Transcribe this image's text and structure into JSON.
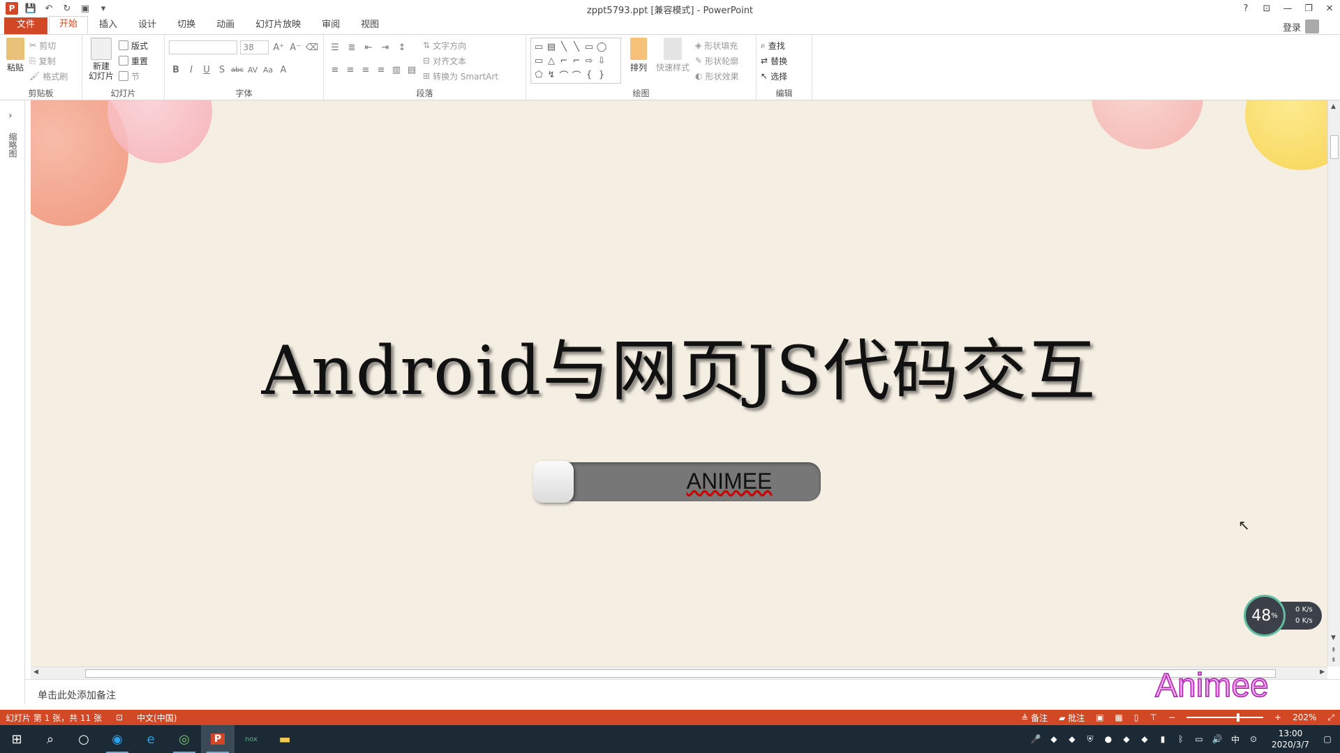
{
  "window": {
    "title": "zppt5793.ppt [兼容模式] - PowerPoint",
    "controls": [
      "?",
      "⊡",
      "—",
      "❐",
      "✕"
    ]
  },
  "qat_icons": [
    "powerpoint-logo-icon",
    "save-icon",
    "undo-icon",
    "redo-icon",
    "start-from-beginning-icon",
    "customize-qat-icon"
  ],
  "tabs": [
    {
      "label": "文件",
      "kind": "file"
    },
    {
      "label": "开始",
      "kind": "active"
    },
    {
      "label": "插入"
    },
    {
      "label": "设计"
    },
    {
      "label": "切换"
    },
    {
      "label": "动画"
    },
    {
      "label": "幻灯片放映"
    },
    {
      "label": "审阅"
    },
    {
      "label": "视图"
    }
  ],
  "account": {
    "login": "登录"
  },
  "ribbon": {
    "clipboard": {
      "label": "剪贴板",
      "paste": "粘贴",
      "cut": "剪切",
      "copy": "复制",
      "format_painter": "格式刷"
    },
    "slides": {
      "label": "幻灯片",
      "new_slide": "新建\n幻灯片",
      "layout": "版式",
      "reset": "重置",
      "section": "节"
    },
    "font": {
      "label": "字体",
      "font_name": "",
      "font_size": "38",
      "buttons": [
        "B",
        "I",
        "U",
        "S",
        "abc",
        "AV",
        "Aa",
        "A"
      ]
    },
    "paragraph": {
      "label": "段落",
      "text_direction": "文字方向",
      "align_text": "对齐文本",
      "convert_smartart": "转换为 SmartArt"
    },
    "drawing": {
      "label": "绘图",
      "arrange": "排列",
      "quick_styles": "快速样式",
      "shape_fill": "形状填充",
      "shape_outline": "形状轮廓",
      "shape_effects": "形状效果",
      "shapes": [
        "▭",
        "▤",
        "╲",
        "╲",
        "▭",
        "◯",
        "▭",
        "△",
        "⌐",
        "⌐",
        "⇨",
        "⇩",
        "⬠",
        "↯",
        "⌒",
        "⌒",
        "{",
        "}"
      ]
    },
    "editing": {
      "label": "编辑",
      "find": "查找",
      "replace": "替换",
      "select": "选择"
    }
  },
  "side_panel": {
    "label": "缩略图"
  },
  "slide": {
    "title": "Android与网页JS代码交互",
    "toggle_label": "ANIMEE"
  },
  "net_widget": {
    "percent": "48",
    "percent_unit": "%",
    "up": "0",
    "down": "0",
    "unit": "K/s"
  },
  "notes": {
    "placeholder": "单击此处添加备注"
  },
  "watermark": "Animee",
  "status": {
    "slide_info": "幻灯片 第 1 张，共 11 张",
    "language": "中文(中国)",
    "notes": "备注",
    "comments": "批注",
    "zoom": "202%"
  },
  "taskbar": {
    "time": "13:00",
    "date": "2020/3/7",
    "ime": "中"
  },
  "colors": {
    "accent": "#d24726",
    "slide_bg": "#f5efe3",
    "taskbar": "#1b2a35"
  }
}
